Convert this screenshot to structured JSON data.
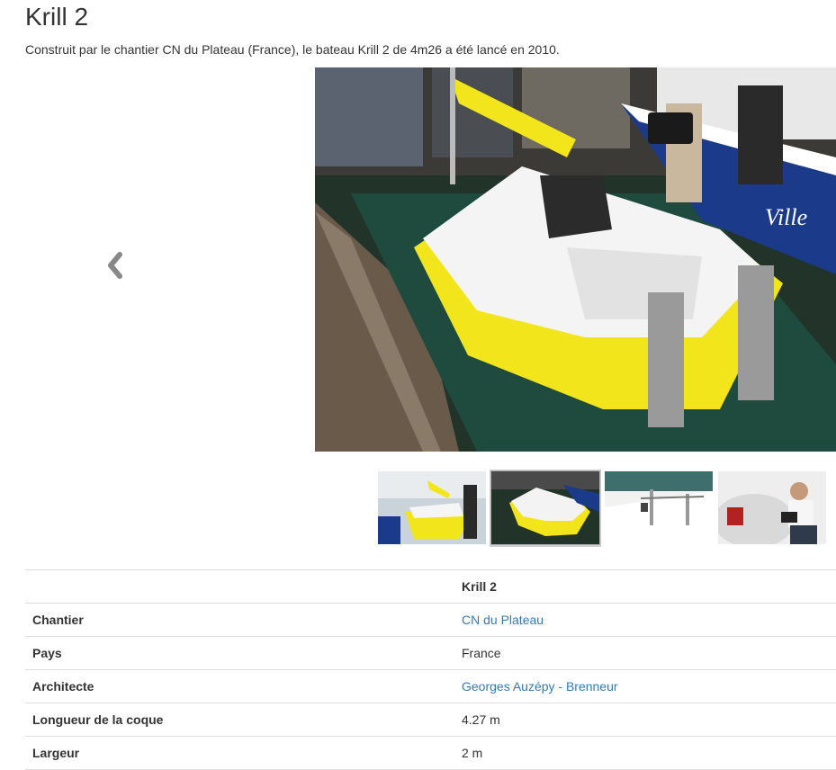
{
  "page": {
    "title": "Krill 2",
    "intro": "Construit par le chantier CN du Plateau (France), le bateau Krill 2 de 4m26 a été lancé en 2010."
  },
  "gallery": {
    "prev_icon": "chevron-left-icon",
    "active_index": 1,
    "thumbnail_count": 4
  },
  "specs": {
    "header_value": "Krill 2",
    "rows": [
      {
        "label": "Chantier",
        "value": "CN du Plateau",
        "link": true
      },
      {
        "label": "Pays",
        "value": "France",
        "link": false
      },
      {
        "label": "Architecte",
        "value": "Georges Auzépy - Brenneur",
        "link": true
      },
      {
        "label": "Longueur de la coque",
        "value": "4.27 m",
        "link": false
      },
      {
        "label": "Largeur",
        "value": "2 m",
        "link": false
      }
    ]
  },
  "colors": {
    "link": "#337ab7",
    "hull": "#f2e51b",
    "text": "#333333"
  }
}
